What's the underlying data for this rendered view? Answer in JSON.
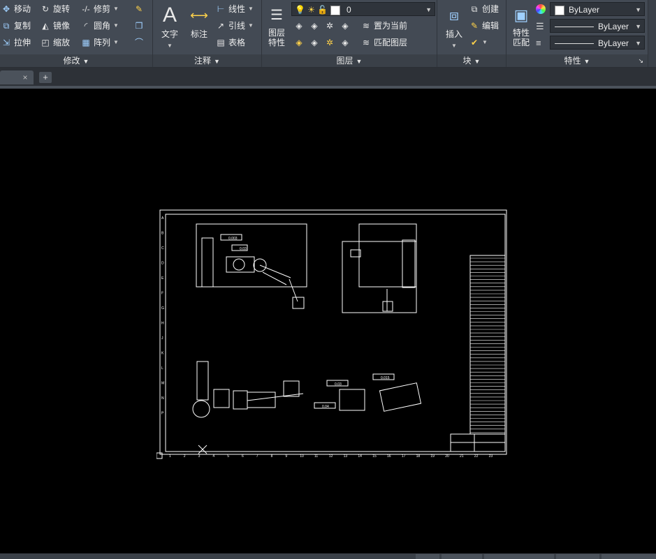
{
  "ribbon": {
    "modify": {
      "title": "修改",
      "tools": {
        "move": "移动",
        "rotate": "旋转",
        "trim": "修剪",
        "copy": "复制",
        "mirror": "镜像",
        "fillet": "圆角",
        "stretch": "拉伸",
        "scale": "缩放",
        "array": "阵列"
      }
    },
    "annotation": {
      "title": "注释",
      "text": "文字",
      "dimension": "标注",
      "linear": "线性",
      "leader": "引线",
      "table": "表格"
    },
    "layers": {
      "title": "图层",
      "layer_properties": "图层\n特性",
      "current_layer": "0",
      "set_current": "置为当前",
      "match_layer": "匹配图层"
    },
    "block": {
      "title": "块",
      "insert": "插入",
      "create": "创建",
      "edit": "编辑"
    },
    "properties": {
      "title": "特性",
      "match_properties": "特性\n匹配",
      "color": "ByLayer",
      "linetype": "ByLayer",
      "lineweight": "ByLayer"
    }
  },
  "tabs": {
    "close": "×",
    "add": "+"
  },
  "drawing": {
    "ruler_letters": [
      "A",
      "B",
      "C",
      "D",
      "E",
      "F",
      "G",
      "H",
      "J",
      "K",
      "L",
      "M",
      "N",
      "P"
    ],
    "ruler_numbers": [
      "1",
      "2",
      "3",
      "4",
      "5",
      "6",
      "7",
      "8",
      "9",
      "10",
      "11",
      "12",
      "13",
      "14",
      "15",
      "16",
      "17",
      "18",
      "19",
      "20",
      "21",
      "22",
      "23"
    ],
    "tolerance_labels": [
      "0.003",
      "0.03",
      "0.03",
      "0.04",
      "0.015"
    ]
  },
  "colors": {
    "ribbon_bg": "#434a54",
    "canvas_bg": "#000000",
    "drawing_line": "#ffffff"
  }
}
